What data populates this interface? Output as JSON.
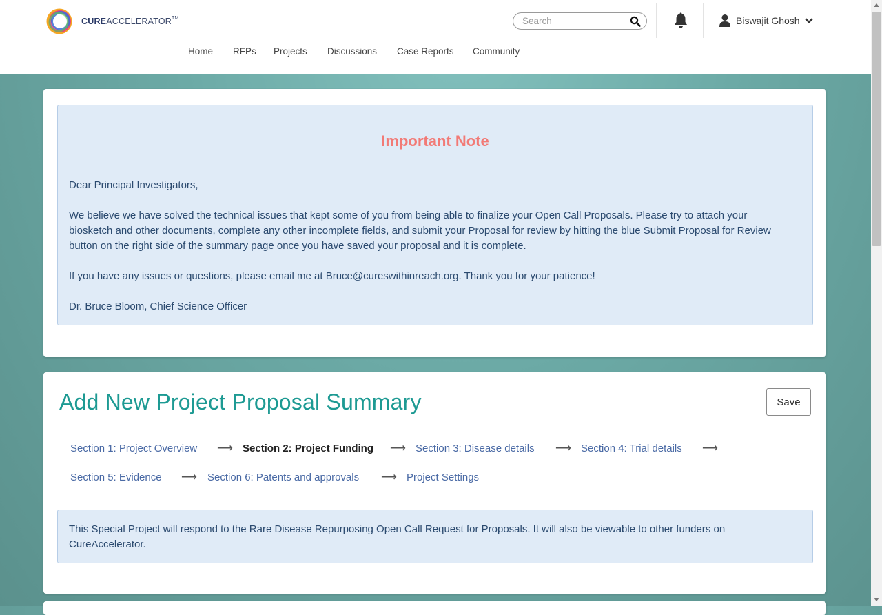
{
  "header": {
    "logo": {
      "brand_bold": "CURE",
      "brand_light": "ACCELERATOR",
      "trademark": "TM"
    },
    "search": {
      "placeholder": "Search",
      "icon": "search-icon"
    },
    "notifications_icon": "bell-icon",
    "user": {
      "name": "Biswajit Ghosh",
      "icon": "user-icon",
      "dropdown_icon": "chevron-down-icon"
    },
    "nav": [
      {
        "label": "Home"
      },
      {
        "label": "RFPs"
      },
      {
        "label": "Projects"
      },
      {
        "label": "Discussions"
      },
      {
        "label": "Case Reports"
      },
      {
        "label": "Community"
      }
    ]
  },
  "note": {
    "title": "Important Note",
    "greeting": "Dear Principal Investigators,",
    "body": "We believe we have solved the technical issues that kept some of you from being able to finalize your Open Call Proposals. Please try to attach your biosketch and other documents, complete any other incomplete fields, and submit your Proposal for review by hitting the blue Submit Proposal for Review button on the right side of the summary page once you have saved your proposal and it is complete.",
    "contact": "If you have any issues or questions, please email me at Bruce@cureswithinreach.org. Thank you for your patience!",
    "signature": "Dr. Bruce Bloom, Chief Science Officer"
  },
  "proposal": {
    "title": "Add New Project Proposal Summary",
    "save_label": "Save",
    "arrow": "⟶",
    "steps": [
      {
        "label": "Section 1: Project Overview",
        "active": false
      },
      {
        "label": "Section 2: Project Funding",
        "active": true
      },
      {
        "label": "Section 3: Disease details",
        "active": false
      },
      {
        "label": "Section 4: Trial details",
        "active": false
      },
      {
        "label": "Section 5: Evidence",
        "active": false
      },
      {
        "label": "Section 6: Patents and approvals",
        "active": false
      },
      {
        "label": "Project Settings",
        "active": false
      }
    ],
    "info": "This Special Project will respond to the Rare Disease Repurposing Open Call Request for Proposals. It will also be viewable to other funders on CureAccelerator."
  },
  "colors": {
    "accent_teal": "#1d9a93",
    "note_title": "#f27a76",
    "link_blue": "#4a6aa5",
    "alert_bg": "#e0ebf7"
  }
}
